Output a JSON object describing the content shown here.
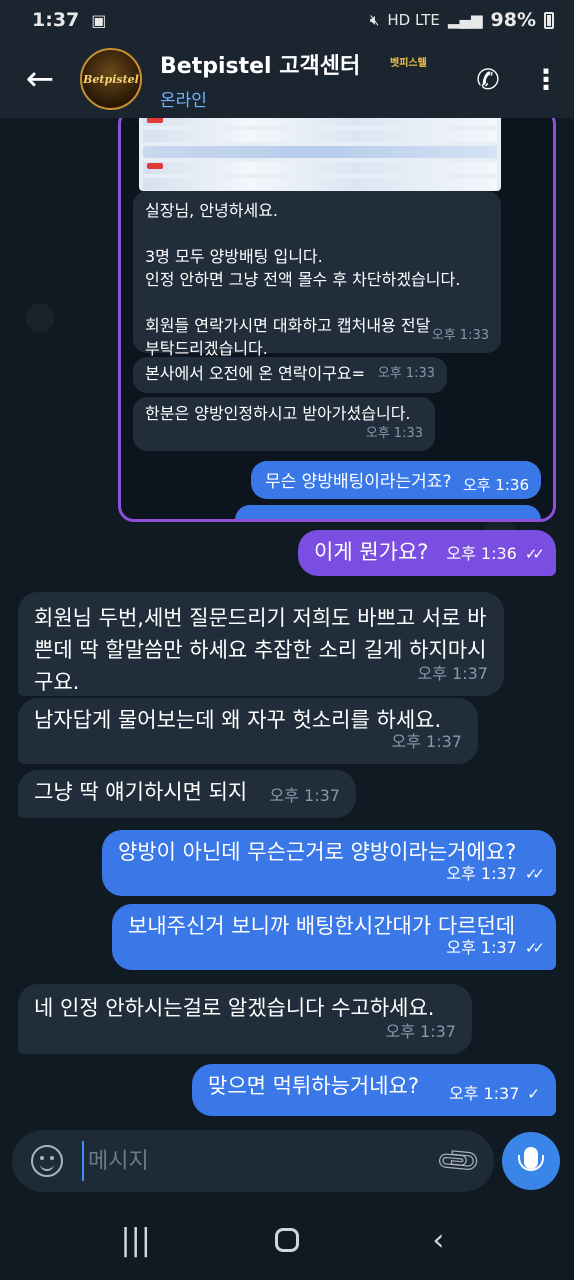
{
  "status_bar": {
    "time": "1:37",
    "indicators": "HD LTE",
    "battery": "98%"
  },
  "header": {
    "avatar_text": "Betpistel",
    "title": "Betpistel 고객센터",
    "status": "온라인",
    "badge": "벳피스텔"
  },
  "quoted_screenshot": {
    "in_messages": [
      {
        "text": "실장님, 안녕하세요.\n\n3명 모두 양방배팅 입니다.\n인정 안하면 그냥 전액 몰수 후 차단하겠습니다.\n\n회원들 연락가시면 대화하고 캡처내용 전달\n부탁드리겠습니다.",
        "time": "오후 1:33"
      },
      {
        "text": "본사에서 오전에 온 연락이구요=",
        "time": "오후 1:33"
      },
      {
        "text": "한분은 양방인정하시고 받아가셨습니다.",
        "time": "오후 1:33"
      }
    ],
    "out_messages": [
      {
        "text": "무슨 양방배팅이라는거죠?",
        "time": "오후 1:36"
      }
    ]
  },
  "messages": [
    {
      "direction": "out",
      "text": "이게 뭔가요?",
      "time": "오후 1:36",
      "status": "read"
    },
    {
      "direction": "in",
      "text": "회원님 두번,세번 질문드리기 저희도 바쁘고 서로 바쁜데 딱 할말씀만 하세요 추잡한 소리 길게 하지마시구요.",
      "time": "오후 1:37"
    },
    {
      "direction": "in",
      "text": "남자답게 물어보는데 왜 자꾸 헛소리를 하세요.",
      "time": "오후 1:37"
    },
    {
      "direction": "in",
      "text": "그냥 딱 얘기하시면 되지",
      "time": "오후 1:37"
    },
    {
      "direction": "out",
      "text": "양방이 아닌데 무슨근거로 양방이라는거에요?",
      "time": "오후 1:37",
      "status": "read"
    },
    {
      "direction": "out",
      "text": "보내주신거 보니까 배팅한시간대가 다르던데",
      "time": "오후 1:37",
      "status": "read"
    },
    {
      "direction": "in",
      "text": "네 인정 안하시는걸로 알겠습니다 수고하세요.",
      "time": "오후 1:37"
    },
    {
      "direction": "out",
      "text": "맞으면 먹튀하능거네요?",
      "time": "오후 1:37",
      "status": "sent"
    }
  ],
  "input": {
    "placeholder": "메시지"
  },
  "icons": {
    "back": "arrow-left-icon",
    "call": "phone-icon",
    "menu": "more-vertical-icon",
    "emoji": "emoji-icon",
    "attach": "paperclip-icon",
    "mic": "microphone-icon"
  },
  "colors": {
    "accent": "#3a78e8",
    "highlight_bubble": "#7a4ee0",
    "status_online": "#6fb3ff",
    "frame_border": "#8e4fd6"
  }
}
